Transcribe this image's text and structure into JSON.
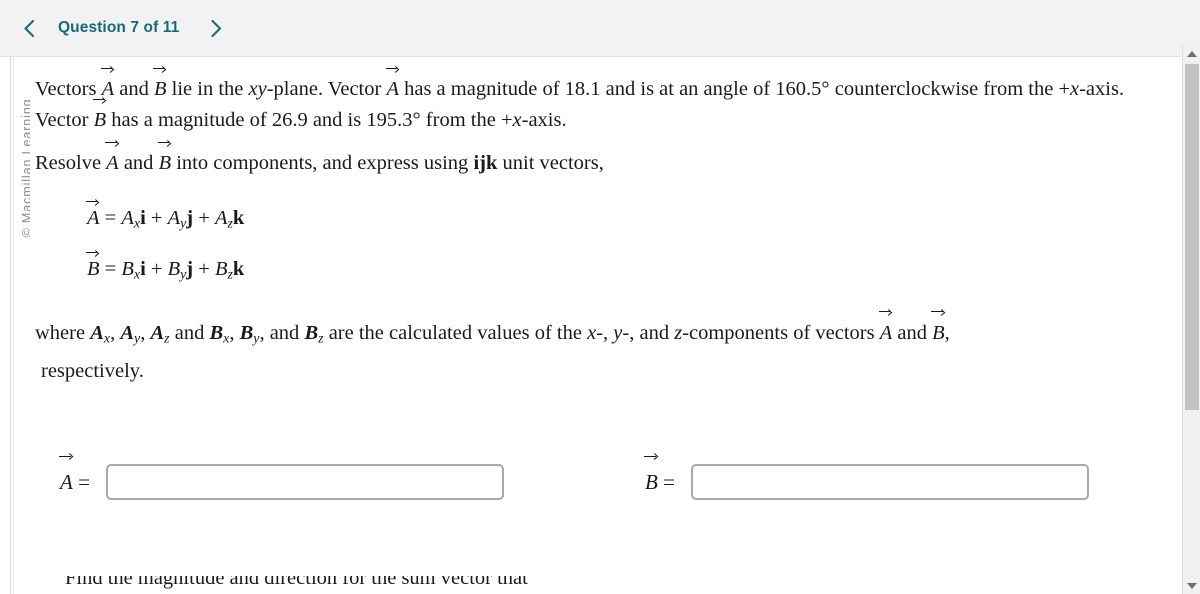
{
  "header": {
    "prev_label": "‹",
    "next_label": "›",
    "question_label": "Question 7 of 11",
    "accent_color": "#15697f"
  },
  "sidebar": {
    "copyright": "© Macmillan Learning"
  },
  "question": {
    "intro": {
      "seg1": "Vectors ",
      "vec_a1": "A",
      "seg2": " and ",
      "vec_b1": "B",
      "seg3": " lie in the ",
      "xy": "xy",
      "seg4": "-plane. Vector ",
      "vec_a2": "A",
      "seg5": " has a magnitude of 18.1 and is at an angle of 160.5° counterclockwise from the +",
      "x1": "x",
      "seg6": "-axis. Vector ",
      "vec_b2": "B",
      "seg7": " has a magnitude of 26.9 and is 195.3° from the +",
      "x2": "x",
      "seg8": "-axis.",
      "magnitude_a": "18.1",
      "angle_a": "160.5°",
      "magnitude_b": "26.9",
      "angle_b": "195.3°"
    },
    "resolve": {
      "seg1": "Resolve ",
      "vec_a": "A",
      "seg2": " and ",
      "vec_b": "B",
      "seg3": " into components, and express using ",
      "ijk": "ijk",
      "seg4": " unit vectors,"
    },
    "equation_a": {
      "lhs": "A",
      "eq": " = ",
      "t1": "A",
      "s1": "x",
      "u1": "i",
      "plus1": " + ",
      "t2": "A",
      "s2": "y",
      "u2": "j",
      "plus2": " + ",
      "t3": "A",
      "s3": "z",
      "u3": "k"
    },
    "equation_b": {
      "lhs": "B",
      "eq": " = ",
      "t1": "B",
      "s1": "x",
      "u1": "i",
      "plus1": " + ",
      "t2": "B",
      "s2": "y",
      "u2": "j",
      "plus2": " + ",
      "t3": "B",
      "s3": "z",
      "u3": "k"
    },
    "where": {
      "w1": "where ",
      "a1": "A",
      "a1s": "x",
      "c1": ", ",
      "a2": "A",
      "a2s": "y",
      "c2": ", ",
      "a3": "A",
      "a3s": "z",
      "c3": " and ",
      "b1": "B",
      "b1s": "x",
      "c4": ", ",
      "b2": "B",
      "b2s": "y",
      "c5": ", and ",
      "b3": "B",
      "b3s": "z",
      "w2": " are the calculated values of the ",
      "x": "x",
      "c6": "-, ",
      "y": "y",
      "c7": "-, and ",
      "z": "z",
      "c8": "-components of vectors ",
      "va": "A",
      "c9": " and ",
      "vb": "B",
      "c10": ",",
      "line2": "respectively."
    },
    "clipped_line": "Find the magnitude and direction for the sum vector that"
  },
  "answers": {
    "a": {
      "label_vec": "A",
      "label_eq": " =",
      "value": "",
      "placeholder": ""
    },
    "b": {
      "label_vec": "B",
      "label_eq": " =",
      "value": "",
      "placeholder": ""
    }
  },
  "scrollbar": {
    "up_icon": "triangle-up-icon",
    "down_icon": "triangle-down-icon"
  }
}
